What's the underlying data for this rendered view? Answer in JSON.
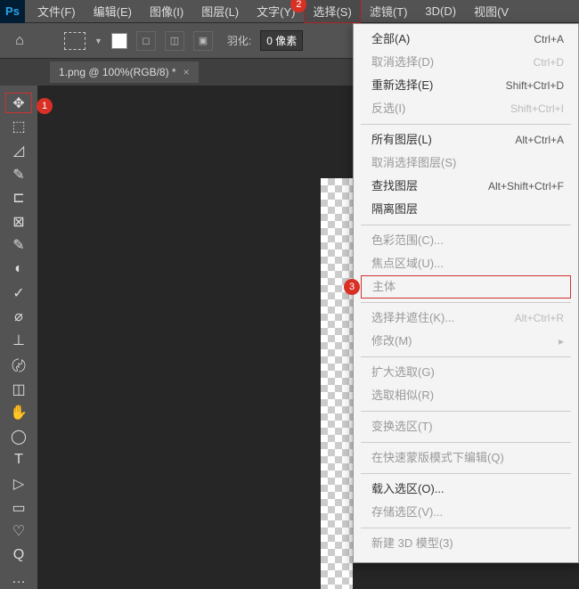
{
  "app": {
    "icon_text": "Ps"
  },
  "menubar": {
    "items": [
      "文件(F)",
      "编辑(E)",
      "图像(I)",
      "图层(L)",
      "文字(Y)",
      "选择(S)",
      "滤镜(T)",
      "3D(D)",
      "视图(V"
    ]
  },
  "markers": {
    "m1": "1",
    "m2": "2",
    "m3": "3"
  },
  "options": {
    "feather_label": "羽化:",
    "feather_value": "0 像素"
  },
  "doc_tab": {
    "title": "1.png @ 100%(RGB/8) *",
    "close": "×"
  },
  "tools": {
    "items": [
      "✥",
      "⬚",
      "◿",
      "✎",
      "⊏",
      "⊠",
      "✎",
      "◐",
      "✓",
      "⌀",
      "⊥",
      "〄",
      "◫",
      "✋",
      "◯",
      "T",
      "▷",
      "▭",
      "♡",
      "Q",
      "…"
    ]
  },
  "dropdown": {
    "items": [
      {
        "label": "全部(A)",
        "shortcut": "Ctrl+A",
        "disabled": false
      },
      {
        "label": "取消选择(D)",
        "shortcut": "Ctrl+D",
        "disabled": true
      },
      {
        "label": "重新选择(E)",
        "shortcut": "Shift+Ctrl+D",
        "disabled": false
      },
      {
        "label": "反选(I)",
        "shortcut": "Shift+Ctrl+I",
        "disabled": true
      },
      {
        "sep": true
      },
      {
        "label": "所有图层(L)",
        "shortcut": "Alt+Ctrl+A",
        "disabled": false
      },
      {
        "label": "取消选择图层(S)",
        "shortcut": "",
        "disabled": true
      },
      {
        "label": "查找图层",
        "shortcut": "Alt+Shift+Ctrl+F",
        "disabled": false
      },
      {
        "label": "隔离图层",
        "shortcut": "",
        "disabled": false
      },
      {
        "sep": true
      },
      {
        "label": "色彩范围(C)...",
        "shortcut": "",
        "disabled": true
      },
      {
        "label": "焦点区域(U)...",
        "shortcut": "",
        "disabled": true
      },
      {
        "label": "主体",
        "shortcut": "",
        "disabled": true,
        "highlight": true
      },
      {
        "sep": true
      },
      {
        "label": "选择并遮住(K)...",
        "shortcut": "Alt+Ctrl+R",
        "disabled": true
      },
      {
        "label": "修改(M)",
        "shortcut": "▸",
        "disabled": true
      },
      {
        "sep": true
      },
      {
        "label": "扩大选取(G)",
        "shortcut": "",
        "disabled": true
      },
      {
        "label": "选取相似(R)",
        "shortcut": "",
        "disabled": true
      },
      {
        "sep": true
      },
      {
        "label": "变换选区(T)",
        "shortcut": "",
        "disabled": true
      },
      {
        "sep": true
      },
      {
        "label": "在快速蒙版模式下编辑(Q)",
        "shortcut": "",
        "disabled": true
      },
      {
        "sep": true
      },
      {
        "label": "载入选区(O)...",
        "shortcut": "",
        "disabled": false
      },
      {
        "label": "存储选区(V)...",
        "shortcut": "",
        "disabled": true
      },
      {
        "sep": true
      },
      {
        "label": "新建 3D 模型(3)",
        "shortcut": "",
        "disabled": true
      }
    ]
  }
}
